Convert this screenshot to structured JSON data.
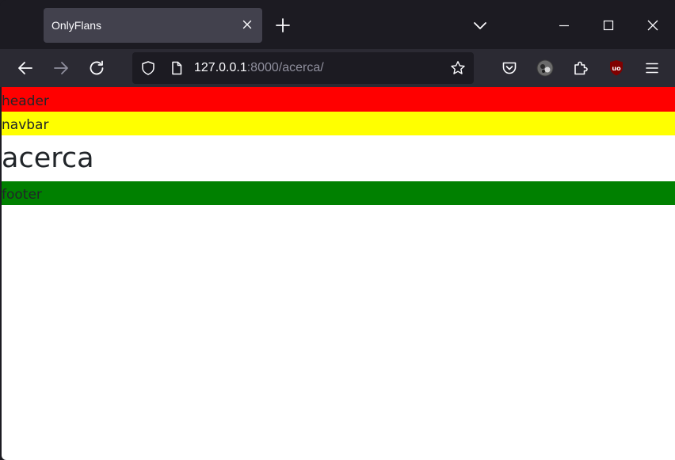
{
  "browser": {
    "tab": {
      "title": "OnlyFlans"
    },
    "url": {
      "host": "127.0.0.1",
      "rest": ":8000/acerca/"
    },
    "icons": {
      "tab_close": "close-icon",
      "new_tab": "plus-icon",
      "tab_list": "chevron-down-icon",
      "back": "arrow-left-icon",
      "forward": "arrow-right-icon",
      "reload": "reload-icon",
      "shield": "shield-icon",
      "page": "page-icon",
      "bookmark": "star-icon",
      "pocket": "pocket-icon",
      "account": "avatar",
      "extensions": "puzzle-icon",
      "ublock": "ublock-icon",
      "menu": "hamburger-icon"
    },
    "colors": {
      "frame": "#1c1b22",
      "toolbar": "#2b2a33",
      "active_tab": "#42414d",
      "ublock": "#800000"
    }
  },
  "page": {
    "header_text": "header",
    "navbar_text": "navbar",
    "main_text": "acerca",
    "footer_text": "footer",
    "colors": {
      "header": "#ff0000",
      "navbar": "#ffff00",
      "main": "#ffffff",
      "footer": "#008000"
    }
  }
}
